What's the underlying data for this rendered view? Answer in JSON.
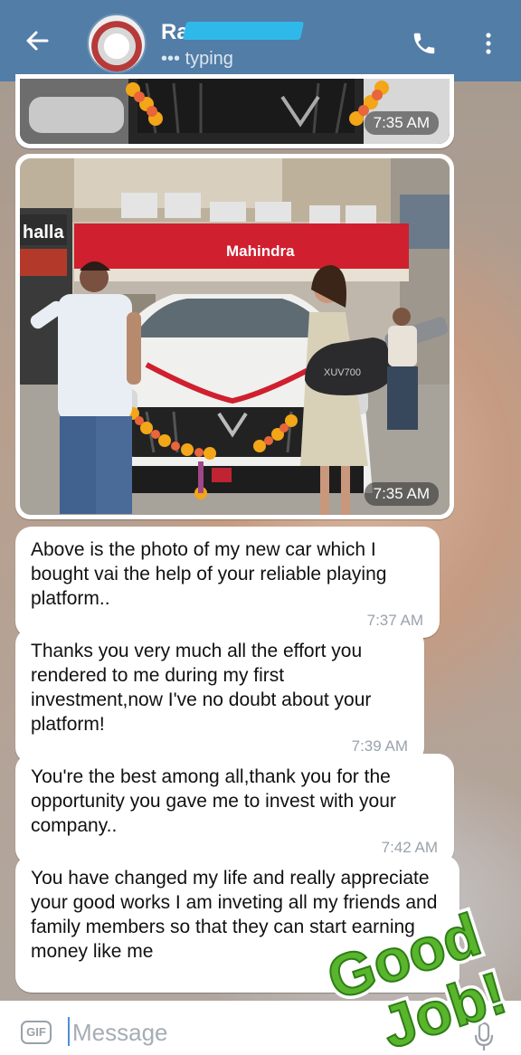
{
  "header": {
    "contact_name": "Ra",
    "status": "••• typing",
    "icons": [
      "back-arrow-icon",
      "phone-icon",
      "more-vert-icon"
    ]
  },
  "colors": {
    "topbar": "#527da6",
    "bubble": "#ffffff",
    "timestamp": "#9aa3ab"
  },
  "messages": [
    {
      "type": "photo",
      "time": "7:35 AM"
    },
    {
      "type": "photo",
      "time": "7:35 AM",
      "sign_text": "Mahindra",
      "key_text": "XUV700"
    },
    {
      "type": "text",
      "text": "Above is the photo of my new car which I bought vai the help of your reliable playing platform..",
      "time": "7:37 AM"
    },
    {
      "type": "text",
      "text": "Thanks you very much all the effort you rendered to me during my first investment,now I've no doubt about your platform!",
      "time": "7:39 AM"
    },
    {
      "type": "text",
      "text": "You're the best among all,thank you for the opportunity you gave me to invest with your company..",
      "time": "7:42 AM"
    },
    {
      "type": "text",
      "text": "You have changed my life and really appreciate your good works I am inveting all my friends and family members so that they can start earning money like me",
      "time": ""
    }
  ],
  "sticker": {
    "line1": "Good",
    "line2": "Job!"
  },
  "composer": {
    "gif_label": "GIF",
    "placeholder": "Message"
  }
}
